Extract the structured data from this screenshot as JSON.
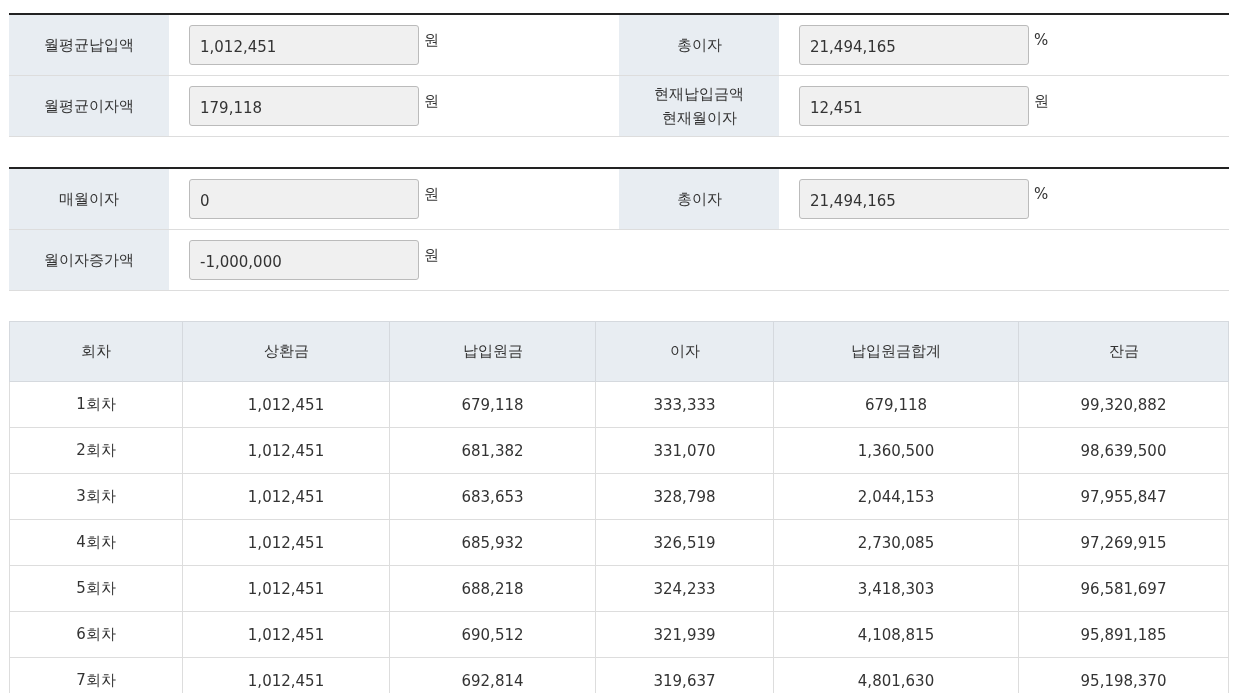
{
  "sections": [
    {
      "rows": [
        {
          "fields": [
            {
              "label": [
                "월평균납입액"
              ],
              "value": "1,012,451",
              "unit": "원"
            },
            {
              "label": [
                "총이자"
              ],
              "value": "21,494,165",
              "unit": "%"
            }
          ]
        },
        {
          "fields": [
            {
              "label": [
                "월평균이자액"
              ],
              "value": "179,118",
              "unit": "원"
            },
            {
              "label": [
                "현재납입금액",
                "현재월이자"
              ],
              "value": "12,451",
              "unit": "원"
            }
          ]
        }
      ]
    },
    {
      "rows": [
        {
          "fields": [
            {
              "label": [
                "매월이자"
              ],
              "value": "0",
              "unit": "원"
            },
            {
              "label": [
                "총이자"
              ],
              "value": "21,494,165",
              "unit": "%"
            }
          ]
        },
        {
          "fields": [
            {
              "label": [
                "월이자증가액"
              ],
              "value": "-1,000,000",
              "unit": "원"
            }
          ]
        }
      ]
    }
  ],
  "table": {
    "columns": [
      "회차",
      "상환금",
      "납입원금",
      "이자",
      "납입원금합계",
      "잔금"
    ],
    "rows": [
      [
        "1회차",
        "1,012,451",
        "679,118",
        "333,333",
        "679,118",
        "99,320,882"
      ],
      [
        "2회차",
        "1,012,451",
        "681,382",
        "331,070",
        "1,360,500",
        "98,639,500"
      ],
      [
        "3회차",
        "1,012,451",
        "683,653",
        "328,798",
        "2,044,153",
        "97,955,847"
      ],
      [
        "4회차",
        "1,012,451",
        "685,932",
        "326,519",
        "2,730,085",
        "97,269,915"
      ],
      [
        "5회차",
        "1,012,451",
        "688,218",
        "324,233",
        "3,418,303",
        "96,581,697"
      ],
      [
        "6회차",
        "1,012,451",
        "690,512",
        "321,939",
        "4,108,815",
        "95,891,185"
      ],
      [
        "7회차",
        "1,012,451",
        "692,814",
        "319,637",
        "4,801,630",
        "95,198,370"
      ]
    ]
  }
}
